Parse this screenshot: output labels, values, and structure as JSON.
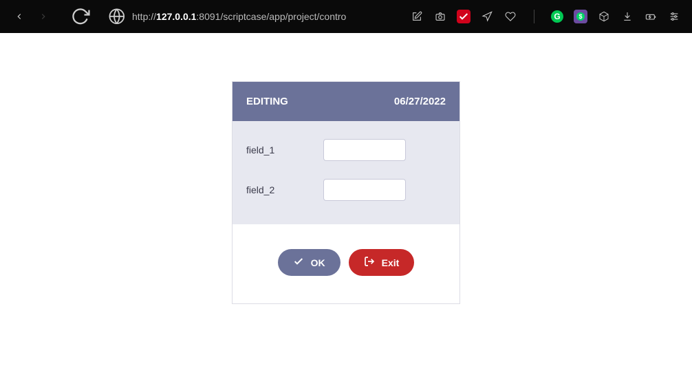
{
  "browser": {
    "url_prefix": "http://",
    "url_host": "127.0.0.1",
    "url_port_path": ":8091/scriptcase/app/project/contro"
  },
  "form": {
    "title": "EDITING",
    "date": "06/27/2022",
    "fields": [
      {
        "label": "field_1",
        "value": ""
      },
      {
        "label": "field_2",
        "value": ""
      }
    ],
    "buttons": {
      "ok_label": "OK",
      "exit_label": "Exit"
    }
  }
}
